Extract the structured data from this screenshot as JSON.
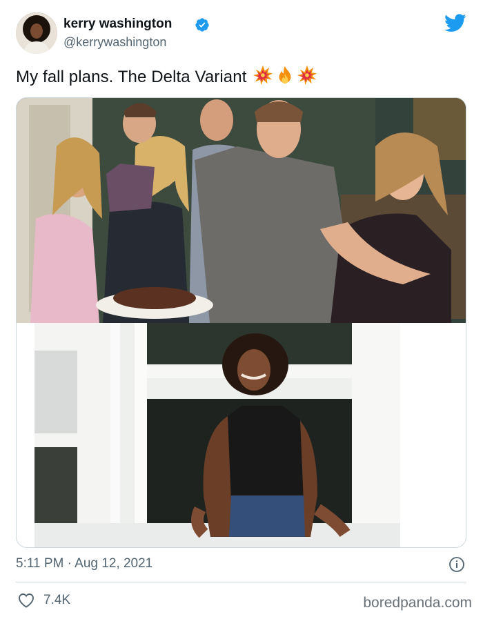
{
  "author": {
    "display_name": "kerry washington",
    "handle": "@kerrywashington",
    "verified": true
  },
  "tweet": {
    "text": "My fall plans. The Delta Variant",
    "emojis": [
      "collision-emoji",
      "fire-emoji",
      "collision-emoji"
    ]
  },
  "media": {
    "top_image": "group-family-photo",
    "bottom_image": "woman-leaning-out-window"
  },
  "footer": {
    "timestamp": "5:11 PM · Aug 12, 2021",
    "like_count": "7.4K"
  },
  "watermark": "boredpanda.com",
  "colors": {
    "twitter_blue": "#1d9bf0",
    "secondary_text": "#536471",
    "border": "#cfd9de"
  }
}
